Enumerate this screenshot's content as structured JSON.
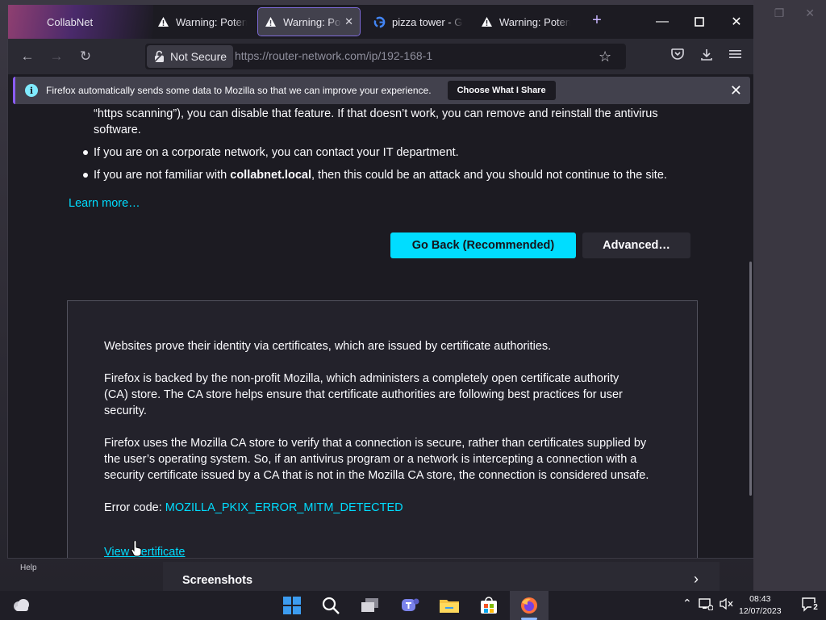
{
  "tabs": [
    {
      "label": "CollabNet",
      "icon": "collabnet-icon",
      "active": false
    },
    {
      "label": "Warning: Potential Security Risk Ahead",
      "icon": "warning-icon",
      "active": false
    },
    {
      "label": "Warning: Potential Security Risk Ahead",
      "icon": "warning-icon",
      "active": true
    },
    {
      "label": "pizza tower - Google Search",
      "icon": "google-icon",
      "active": false
    },
    {
      "label": "Warning: Potential Security Risk Ahead",
      "icon": "warning-icon",
      "active": false
    }
  ],
  "navbar": {
    "not_secure": "Not Secure",
    "url_prefix": "https://",
    "url_rest": "router-network.com/ip/192-168-1"
  },
  "notification": {
    "message": "Firefox automatically sends some data to Mozilla so that we can improve your experience.",
    "button": "Choose What I Share"
  },
  "content": {
    "intro_line1": "“https scanning”), you can disable that feature. If that doesn’t work, you can remove and reinstall the antivirus",
    "intro_line2": "software.",
    "bullet1": "If you are on a corporate network, you can contact your IT department.",
    "bullet2_pre": "If you are not familiar with ",
    "bullet2_bold": "collabnet.local",
    "bullet2_post": ", then this could be an attack and you should not continue to the site.",
    "learn_more": "Learn more…",
    "go_back": "Go Back (Recommended)",
    "advanced": "Advanced…"
  },
  "advanced_panel": {
    "p1": "Websites prove their identity via certificates, which are issued by certificate authorities.",
    "p2_l1": "Firefox is backed by the non-profit Mozilla, which administers a completely open certificate authority",
    "p2_l2": "(CA) store. The CA store helps ensure that certificate authorities are following best practices for user",
    "p2_l3": "security.",
    "p3_l1": "Firefox uses the Mozilla CA store to verify that a connection is secure, rather than certificates supplied by",
    "p3_l2": "the user’s operating system. So, if an antivirus program or a network is intercepting a connection with a",
    "p3_l3": "security certificate issued by a CA that is not in the Mozilla CA store, the connection is considered unsafe.",
    "error_label": "Error code: ",
    "error_code": "MOZILLA_PKIX_ERROR_MITM_DETECTED",
    "view_certificate": "View Certificate"
  },
  "help_tooltip": "Help",
  "screenshots_panel": {
    "title": "Screenshots"
  },
  "taskbar": {
    "time": "08:43",
    "date": "12/07/2023",
    "notification_count": "2"
  },
  "colors": {
    "accent": "#00ddff",
    "tab_highlight": "#7e6bd8",
    "notif_border": "#8b5cf6"
  }
}
